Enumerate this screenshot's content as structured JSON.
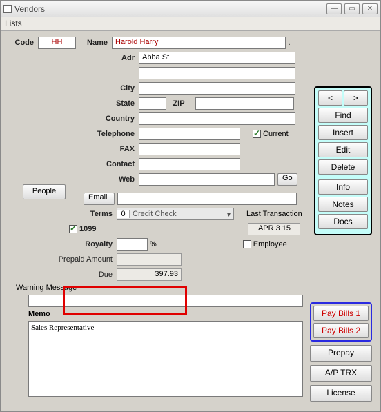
{
  "window": {
    "title": "Vendors"
  },
  "menu": {
    "lists": "Lists"
  },
  "labels": {
    "code": "Code",
    "name": "Name",
    "adr": "Adr",
    "city": "City",
    "state": "State",
    "zip": "ZIP",
    "country": "Country",
    "telephone": "Telephone",
    "fax": "FAX",
    "contact": "Contact",
    "web": "Web",
    "email": "Email",
    "terms": "Terms",
    "ten99": "1099",
    "royalty": "Royalty",
    "prepaid": "Prepaid Amount",
    "due": "Due",
    "warning": "Warning Message",
    "memo": "Memo",
    "current": "Current",
    "lasttx": "Last Transaction",
    "employee": "Employee",
    "pct": "%"
  },
  "values": {
    "code": "HH",
    "name": "Harold Harry",
    "adr1": "Abba St",
    "adr2": "",
    "city": "",
    "state": "",
    "zip": "",
    "country": "",
    "telephone": "",
    "fax": "",
    "contact": "",
    "web": "",
    "email": "",
    "terms_num": "0",
    "terms_text": "Credit Check",
    "royalty": "",
    "prepaid": "",
    "due": "397.93",
    "warning": "",
    "memo": "Sales Representative",
    "lasttx": "APR 3 15"
  },
  "checks": {
    "ten99": true,
    "current": true,
    "employee": false
  },
  "buttons": {
    "people": "People",
    "go": "Go",
    "prev": "<",
    "next": ">",
    "find": "Find",
    "insert": "Insert",
    "edit": "Edit",
    "delete": "Delete",
    "info": "Info",
    "notes": "Notes",
    "docs": "Docs",
    "paybills1": "Pay Bills 1",
    "paybills2": "Pay Bills 2",
    "prepay": "Prepay",
    "aptrx": "A/P TRX",
    "license": "License"
  }
}
